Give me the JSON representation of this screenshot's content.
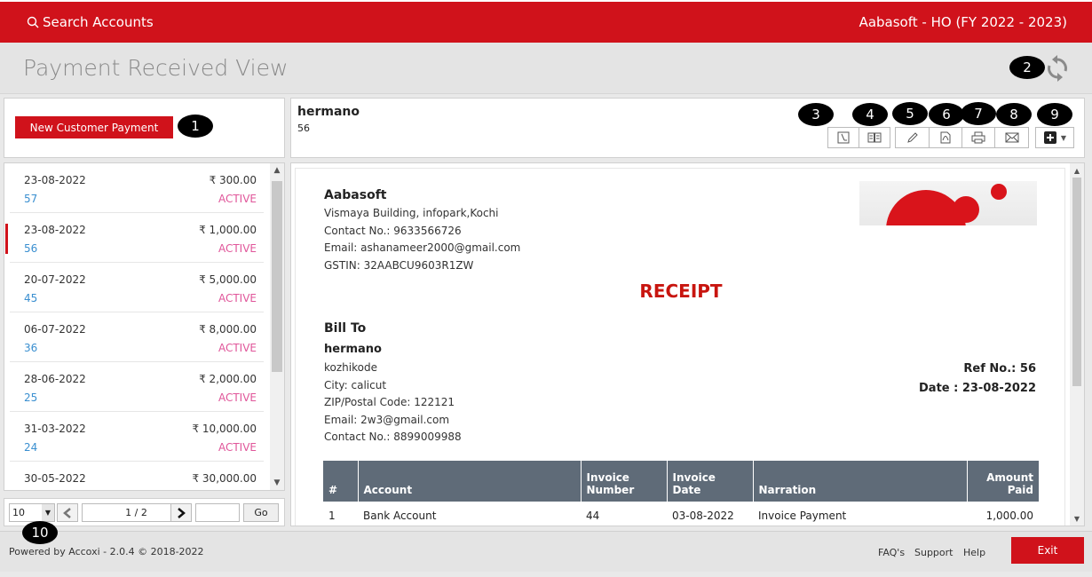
{
  "header": {
    "search_label": "Search Accounts",
    "company": "Aabasoft - HO (FY 2022 - 2023)"
  },
  "page": {
    "title": "Payment Received View"
  },
  "left": {
    "new_button": "New Customer Payment"
  },
  "list": {
    "items": [
      {
        "date": "23-08-2022",
        "amount": "₹ 300.00",
        "number": "57",
        "status": "ACTIVE"
      },
      {
        "date": "23-08-2022",
        "amount": "₹ 1,000.00",
        "number": "56",
        "status": "ACTIVE"
      },
      {
        "date": "20-07-2022",
        "amount": "₹ 5,000.00",
        "number": "45",
        "status": "ACTIVE"
      },
      {
        "date": "06-07-2022",
        "amount": "₹ 8,000.00",
        "number": "36",
        "status": "ACTIVE"
      },
      {
        "date": "28-06-2022",
        "amount": "₹ 2,000.00",
        "number": "25",
        "status": "ACTIVE"
      },
      {
        "date": "31-03-2022",
        "amount": "₹ 10,000.00",
        "number": "24",
        "status": "ACTIVE"
      },
      {
        "date": "30-05-2022",
        "amount": "₹ 30,000.00",
        "number": "",
        "status": ""
      }
    ]
  },
  "pager": {
    "page_size": "10",
    "page": "1 / 2",
    "go": "Go"
  },
  "detail": {
    "name": "hermano",
    "number": "56"
  },
  "badges": [
    "1",
    "2",
    "3",
    "4",
    "5",
    "6",
    "7",
    "8",
    "9",
    "10"
  ],
  "icons": {
    "refresh": "refresh-icon",
    "history": "history-icon",
    "journal": "journal-icon",
    "edit": "pencil-icon",
    "pdf": "pdf-icon",
    "print": "printer-icon",
    "email": "envelope-icon",
    "more": "plus-icon"
  },
  "doc": {
    "company": "Aabasoft",
    "company_lines": [
      "Vismaya Building, infopark,Kochi",
      "Contact No.: 9633566726",
      "Email: ashanameer2000@gmail.com",
      "GSTIN: 32AABCU9603R1ZW"
    ],
    "title": "RECEIPT",
    "bill_to": "Bill To",
    "bill_name": "hermano",
    "bill_lines": [
      "kozhikode",
      "City: calicut",
      "ZIP/Postal Code: 122121",
      "Email: 2w3@gmail.com",
      "Contact No.: 8899009988"
    ],
    "ref": "Ref No.: 56",
    "date": "Date : 23-08-2022",
    "table": {
      "headers": [
        "#",
        "Account",
        "Invoice Number",
        "Invoice Date",
        "Narration",
        "Amount Paid"
      ],
      "rows": [
        [
          "1",
          "Bank Account",
          "44",
          "03-08-2022",
          "Invoice Payment",
          "1,000.00"
        ]
      ]
    }
  },
  "footer": {
    "powered": "Powered by Accoxi - 2.0.4 © 2018-2022",
    "faq": "FAQ's",
    "support": "Support",
    "help": "Help",
    "exit": "Exit"
  },
  "colors": {
    "brand": "#d0121b",
    "link_blue": "#3a8fd0",
    "status_pink": "#e0569a",
    "table_header": "#5f6b78"
  }
}
